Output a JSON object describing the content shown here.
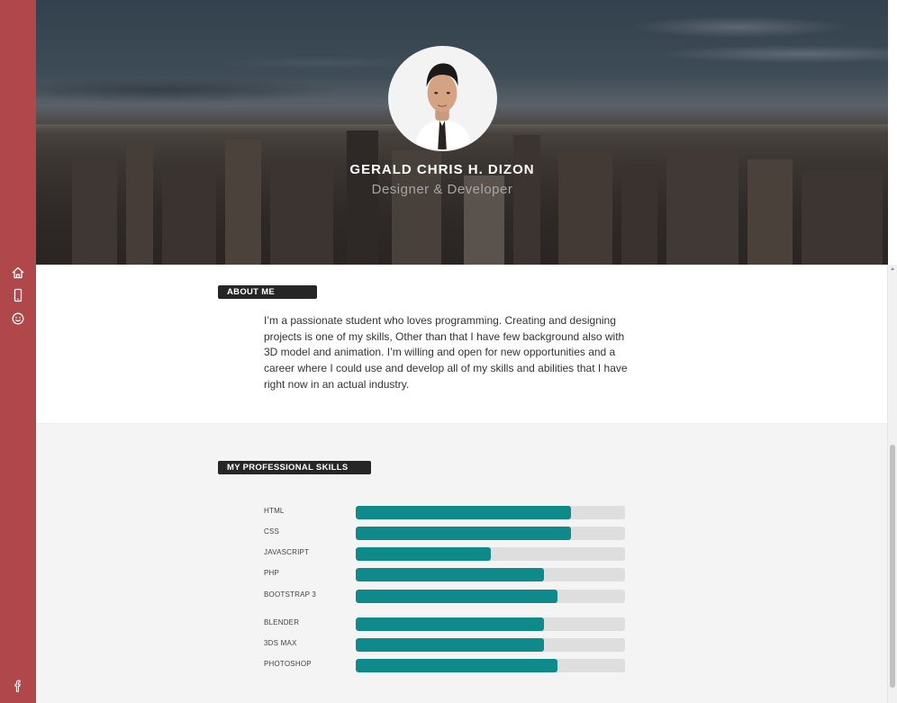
{
  "sidebar": {
    "icons": [
      "home-icon",
      "phone-icon",
      "smiley-icon",
      "facebook-icon"
    ],
    "color": "#b0474a"
  },
  "hero": {
    "name": "GERALD CHRIS H. DIZON",
    "role": "Designer & Developer"
  },
  "about": {
    "heading": "ABOUT ME",
    "text": "I’m a passionate student who loves programming. Creating and designing projects is one of my skills, Other than that I have few background also with 3D model and animation. I’m willing and open for new opportunities and a career where I could use and develop all of my skills and abilities that I have right now in an actual industry."
  },
  "skills": {
    "heading": "MY PROFESSIONAL SKILLS",
    "bar_color": "#0e8a8a",
    "track_color": "#dedede",
    "items": [
      {
        "label": "HTML",
        "level": 0.8
      },
      {
        "label": "CSS",
        "level": 0.8
      },
      {
        "label": "JAVASCRIPT",
        "level": 0.5
      },
      {
        "label": "PHP",
        "level": 0.7
      },
      {
        "label": "BOOTSTRAP 3",
        "level": 0.75
      },
      {
        "label": "BLENDER",
        "level": 0.7
      },
      {
        "label": "3DS MAX",
        "level": 0.7
      },
      {
        "label": "PHOTOSHOP",
        "level": 0.75
      }
    ]
  }
}
